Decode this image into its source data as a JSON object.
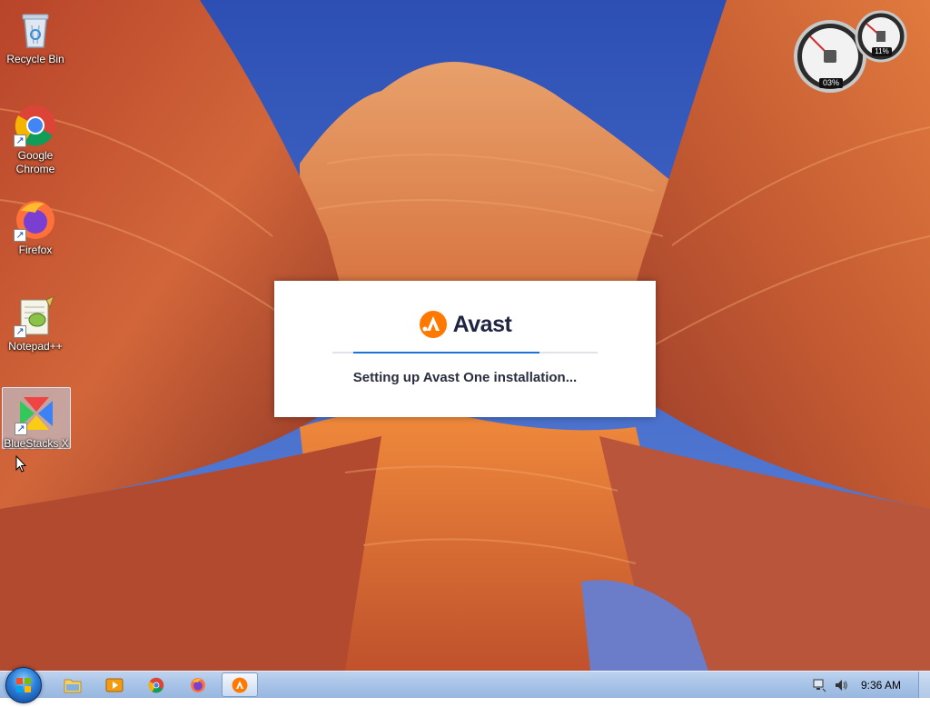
{
  "desktop": {
    "icons": [
      {
        "label": "Recycle Bin",
        "icon": "recycle-bin-icon"
      },
      {
        "label": "Google Chrome",
        "icon": "chrome-icon"
      },
      {
        "label": "Firefox",
        "icon": "firefox-icon"
      },
      {
        "label": "Notepad++",
        "icon": "notepad-plus-plus-icon"
      },
      {
        "label": "BlueStacks X",
        "icon": "bluestacks-icon"
      }
    ]
  },
  "gadget": {
    "cpu_label": "03%",
    "memory_label": "11%"
  },
  "splash": {
    "brand": "Avast",
    "status": "Setting up Avast One installation...",
    "progress": 0.78,
    "colors": {
      "accent": "#ff7800",
      "progress": "#1a73d9",
      "text": "#1f2440"
    }
  },
  "taskbar": {
    "items": [
      {
        "icon": "file-explorer-icon"
      },
      {
        "icon": "media-player-icon"
      },
      {
        "icon": "chrome-icon"
      },
      {
        "icon": "firefox-icon"
      },
      {
        "icon": "avast-icon",
        "active": true
      }
    ],
    "tray": {
      "clock": "9:36 AM",
      "icons": [
        "network-icon",
        "volume-icon"
      ]
    }
  }
}
